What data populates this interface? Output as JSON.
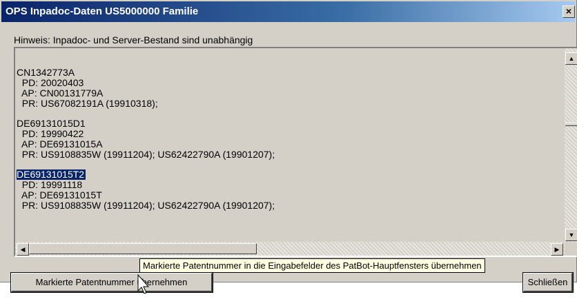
{
  "window": {
    "title": "OPS Inpadoc-Daten US5000000 Familie",
    "close_symbol": "×"
  },
  "hint": "Hinweis: Inpadoc- und Server-Bestand sind unabhängig",
  "entries": [
    {
      "number": "CN1342773A",
      "pd": "PD: 20020403",
      "ap": "AP: CN00131779A",
      "pr": "PR: US67082191A (19910318);"
    },
    {
      "number": "DE69131015D1",
      "pd": "PD: 19990422",
      "ap": "AP: DE69131015A",
      "pr": "PR: US9108835W (19911204); US62422790A (19901207);"
    },
    {
      "number": "DE69131015T2",
      "pd": "PD: 19991118",
      "ap": "AP: DE69131015T",
      "pr": "PR: US9108835W (19911204); US62422790A (19901207);",
      "selected": true
    }
  ],
  "tooltip": "Markierte Patentnummer in die Eingabefelder des PatBot-Hauptfensters übernehmen",
  "buttons": {
    "transfer": "Markierte Patentnummer übernehmen",
    "close": "Schließen"
  },
  "icons": {
    "scroll_up": "scroll-up-arrow-icon",
    "scroll_down": "scroll-down-arrow-icon",
    "scroll_left": "scroll-left-arrow-icon",
    "scroll_right": "scroll-right-arrow-icon",
    "cursor": "mouse-pointer-icon"
  },
  "colors": {
    "titlebar_start": "#0a246a",
    "titlebar_end": "#a6caf0",
    "selection": "#0a246a",
    "tooltip_bg": "#ffffe1",
    "dialog_bg": "#d4d0c8"
  }
}
